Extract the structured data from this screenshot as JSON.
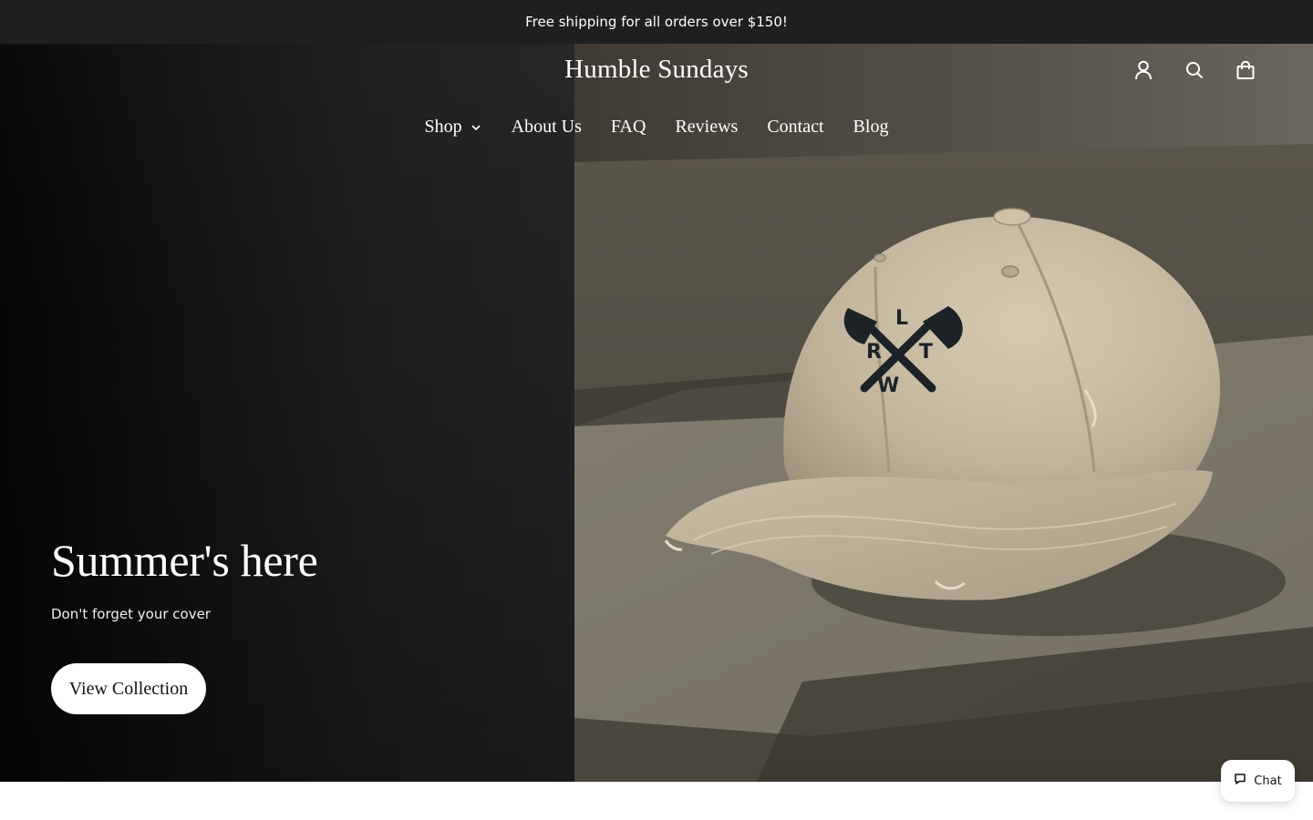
{
  "announcement": {
    "text": "Free shipping for all orders over $150!"
  },
  "header": {
    "logo": "Humble Sundays",
    "icons": [
      "account-icon",
      "search-icon",
      "cart-icon"
    ]
  },
  "nav": {
    "items": [
      {
        "label": "Shop",
        "has_dropdown": true
      },
      {
        "label": "About Us"
      },
      {
        "label": "FAQ"
      },
      {
        "label": "Reviews"
      },
      {
        "label": "Contact"
      },
      {
        "label": "Blog"
      }
    ]
  },
  "hero": {
    "title": "Summer's here",
    "subtitle": "Don't forget your cover",
    "button_label": "View Collection",
    "image_subject": "beige distressed baseball cap",
    "cap_logo_letters": "L R T W"
  },
  "chat": {
    "label": "Chat"
  },
  "colors": {
    "announcement_bg": "#1f1f20",
    "hero_left_bg": "#1a1a1b",
    "button_bg": "#ffffff",
    "text_on_dark": "#ffffff"
  }
}
